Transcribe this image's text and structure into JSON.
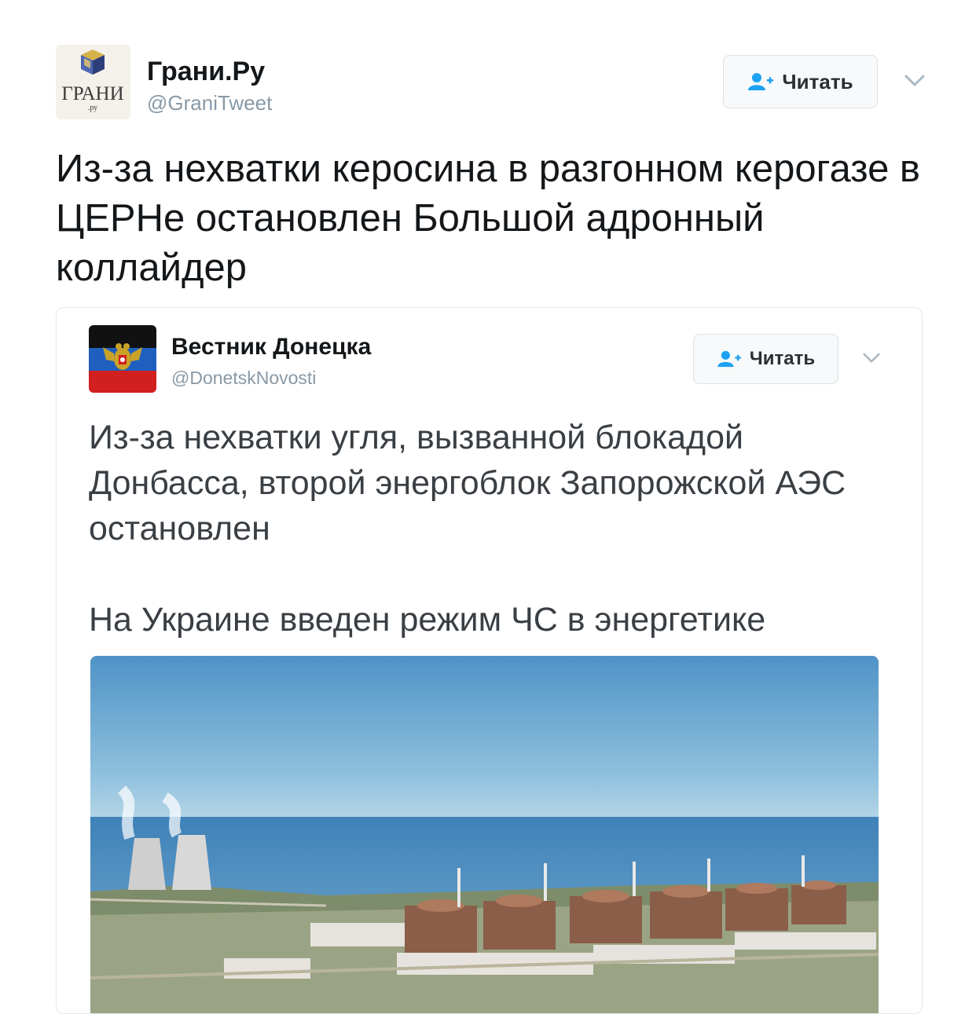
{
  "tweet": {
    "author_name": "Грани.Ру",
    "author_handle": "@GraniTweet",
    "avatar_logo_text": "ГРАНИ",
    "avatar_logo_subtext": ".ру",
    "follow_label": "Читать",
    "text": "Из-за нехватки керосина в разгонном керогазе в ЦЕРНе остановлен Большой адронный коллайдер"
  },
  "quoted_tweet": {
    "author_name": "Вестник Донецка",
    "author_handle": "@DonetskNovosti",
    "follow_label": "Читать",
    "text_line1": "Из-за нехватки угля, вызванной блокадой Донбасса, второй энергоблок Запорожской АЭС остановлен",
    "text_line2": "На Украине введен режим ЧС в энергетике",
    "flag_colors": [
      "#111111",
      "#1f5fbf",
      "#d21f1f"
    ]
  },
  "colors": {
    "handle": "#8899a6",
    "button_bg": "#f7f9fa",
    "border": "#e1e8ed",
    "accent": "#1da1f2"
  },
  "icons": [
    "follow-user-icon",
    "chevron-down-icon"
  ]
}
